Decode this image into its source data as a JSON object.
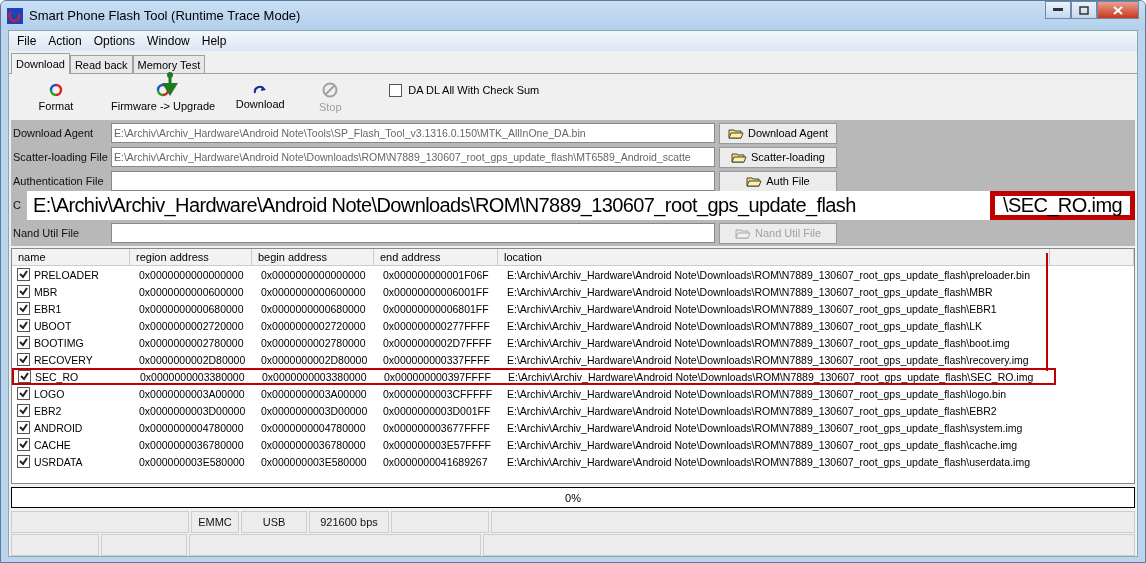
{
  "window": {
    "title": "Smart Phone Flash Tool (Runtime Trace Mode)"
  },
  "menu": [
    "File",
    "Action",
    "Options",
    "Window",
    "Help"
  ],
  "tabs": [
    {
      "label": "Download",
      "selected": true
    },
    {
      "label": "Read back",
      "selected": false
    },
    {
      "label": "Memory Test",
      "selected": false
    }
  ],
  "toolbar": [
    {
      "label": "Format",
      "kind": "format",
      "disabled": false
    },
    {
      "label": "Firmware -> Upgrade",
      "kind": "upgrade",
      "disabled": false
    },
    {
      "label": "Download",
      "kind": "download",
      "disabled": false
    },
    {
      "label": "Stop",
      "kind": "stop",
      "disabled": true
    }
  ],
  "checksum": {
    "label": "DA DL All With Check Sum",
    "checked": false
  },
  "files": [
    {
      "label": "Download Agent",
      "value": "E:\\Archiv\\Archiv_Hardware\\Android Note\\Tools\\SP_Flash_Tool_v3.1316.0.150\\MTK_AllInOne_DA.bin",
      "button": "Download Agent",
      "disabled": false
    },
    {
      "label": "Scatter-loading File",
      "value": "E:\\Archiv\\Archiv_Hardware\\Android Note\\Downloads\\ROM\\N7889_130607_root_gps_update_flash\\MT6589_Android_scatte",
      "button": "Scatter-loading",
      "disabled": false
    },
    {
      "label": "Authentication File",
      "button": "Auth File",
      "disabled": false
    },
    {
      "label": "C"
    },
    {
      "label": "Nand Util File",
      "button": "Nand Util File",
      "disabled": true
    }
  ],
  "table": {
    "columns": [
      "name",
      "region address",
      "begin address",
      "end address",
      "location"
    ],
    "rows": [
      {
        "checked": true,
        "highlighted": false,
        "cells": [
          "PRELOADER",
          "0x0000000000000000",
          "0x0000000000000000",
          "0x000000000001F06F",
          "E:\\Archiv\\Archiv_Hardware\\Android Note\\Downloads\\ROM\\N7889_130607_root_gps_update_flash\\preloader.bin"
        ]
      },
      {
        "checked": true,
        "highlighted": false,
        "cells": [
          "MBR",
          "0x0000000000600000",
          "0x0000000000600000",
          "0x00000000006001FF",
          "E:\\Archiv\\Archiv_Hardware\\Android Note\\Downloads\\ROM\\N7889_130607_root_gps_update_flash\\MBR"
        ]
      },
      {
        "checked": true,
        "highlighted": false,
        "cells": [
          "EBR1",
          "0x0000000000680000",
          "0x0000000000680000",
          "0x00000000006801FF",
          "E:\\Archiv\\Archiv_Hardware\\Android Note\\Downloads\\ROM\\N7889_130607_root_gps_update_flash\\EBR1"
        ]
      },
      {
        "checked": true,
        "highlighted": false,
        "cells": [
          "UBOOT",
          "0x0000000002720000",
          "0x0000000002720000",
          "0x000000000277FFFF",
          "E:\\Archiv\\Archiv_Hardware\\Android Note\\Downloads\\ROM\\N7889_130607_root_gps_update_flash\\LK"
        ]
      },
      {
        "checked": true,
        "highlighted": false,
        "cells": [
          "BOOTIMG",
          "0x0000000002780000",
          "0x0000000002780000",
          "0x0000000002D7FFFF",
          "E:\\Archiv\\Archiv_Hardware\\Android Note\\Downloads\\ROM\\N7889_130607_root_gps_update_flash\\boot.img"
        ]
      },
      {
        "checked": true,
        "highlighted": false,
        "cells": [
          "RECOVERY",
          "0x0000000002D80000",
          "0x0000000002D80000",
          "0x000000000337FFFF",
          "E:\\Archiv\\Archiv_Hardware\\Android Note\\Downloads\\ROM\\N7889_130607_root_gps_update_flash\\recovery.img"
        ]
      },
      {
        "checked": true,
        "highlighted": true,
        "cells": [
          "SEC_RO",
          "0x0000000003380000",
          "0x0000000003380000",
          "0x000000000397FFFF",
          "E:\\Archiv\\Archiv_Hardware\\Android Note\\Downloads\\ROM\\N7889_130607_root_gps_update_flash\\SEC_RO.img"
        ]
      },
      {
        "checked": true,
        "highlighted": false,
        "cells": [
          "LOGO",
          "0x0000000003A00000",
          "0x0000000003A00000",
          "0x0000000003CFFFFF",
          "E:\\Archiv\\Archiv_Hardware\\Android Note\\Downloads\\ROM\\N7889_130607_root_gps_update_flash\\logo.bin"
        ]
      },
      {
        "checked": true,
        "highlighted": false,
        "cells": [
          "EBR2",
          "0x0000000003D00000",
          "0x0000000003D00000",
          "0x0000000003D001FF",
          "E:\\Archiv\\Archiv_Hardware\\Android Note\\Downloads\\ROM\\N7889_130607_root_gps_update_flash\\EBR2"
        ]
      },
      {
        "checked": true,
        "highlighted": false,
        "cells": [
          "ANDROID",
          "0x0000000004780000",
          "0x0000000004780000",
          "0x000000003677FFFF",
          "E:\\Archiv\\Archiv_Hardware\\Android Note\\Downloads\\ROM\\N7889_130607_root_gps_update_flash\\system.img"
        ]
      },
      {
        "checked": true,
        "highlighted": false,
        "cells": [
          "CACHE",
          "0x0000000036780000",
          "0x0000000036780000",
          "0x000000003E57FFFF",
          "E:\\Archiv\\Archiv_Hardware\\Android Note\\Downloads\\ROM\\N7889_130607_root_gps_update_flash\\cache.img"
        ]
      },
      {
        "checked": true,
        "highlighted": false,
        "cells": [
          "USRDATA",
          "0x000000003E580000",
          "0x000000003E580000",
          "0x0000000041689267",
          "E:\\Archiv\\Archiv_Hardware\\Android Note\\Downloads\\ROM\\N7889_130607_root_gps_update_flash\\userdata.img"
        ]
      }
    ]
  },
  "progress": {
    "level": 0,
    "text": "0%"
  },
  "status": [
    "EMMC",
    "USB",
    "921600 bps"
  ],
  "callout": {
    "path": "E:\\Archiv\\Archiv_Hardware\\Android Note\\Downloads\\ROM\\N7889_130607_root_gps_update_flash",
    "file": "\\SEC_RO.img"
  }
}
